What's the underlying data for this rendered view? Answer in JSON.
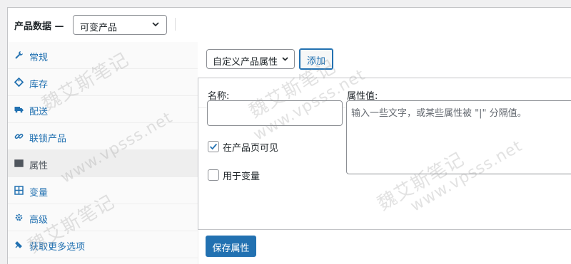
{
  "header": {
    "title": "产品数据 —",
    "product_type": "可变产品"
  },
  "tabs": [
    {
      "label": "常规",
      "icon": "wrench-icon"
    },
    {
      "label": "库存",
      "icon": "tag-icon"
    },
    {
      "label": "配送",
      "icon": "truck-icon"
    },
    {
      "label": "联锁产品",
      "icon": "link-icon"
    },
    {
      "label": "属性",
      "icon": "list-icon",
      "active": true
    },
    {
      "label": "变量",
      "icon": "grid-icon"
    },
    {
      "label": "高级",
      "icon": "gear-icon"
    },
    {
      "label": "获取更多选项",
      "icon": "plugin-icon"
    }
  ],
  "attributes": {
    "select_value": "自定义产品属性",
    "add_label": "添加",
    "name_label": "名称:",
    "name_value": "",
    "value_label": "属性值:",
    "value_placeholder": "输入一些文字，或某些属性被 \"|\" 分隔值。",
    "visible_label": "在产品页可见",
    "visible_checked": true,
    "variation_label": "用于变量",
    "variation_checked": false,
    "save_label": "保存属性"
  },
  "watermark": {
    "text1": "魏艾斯笔记",
    "text2": "www.vpsss.net"
  },
  "colors": {
    "accent": "#2271b1",
    "link": "#2271b1",
    "active_tab_bg": "#eeeeee"
  }
}
